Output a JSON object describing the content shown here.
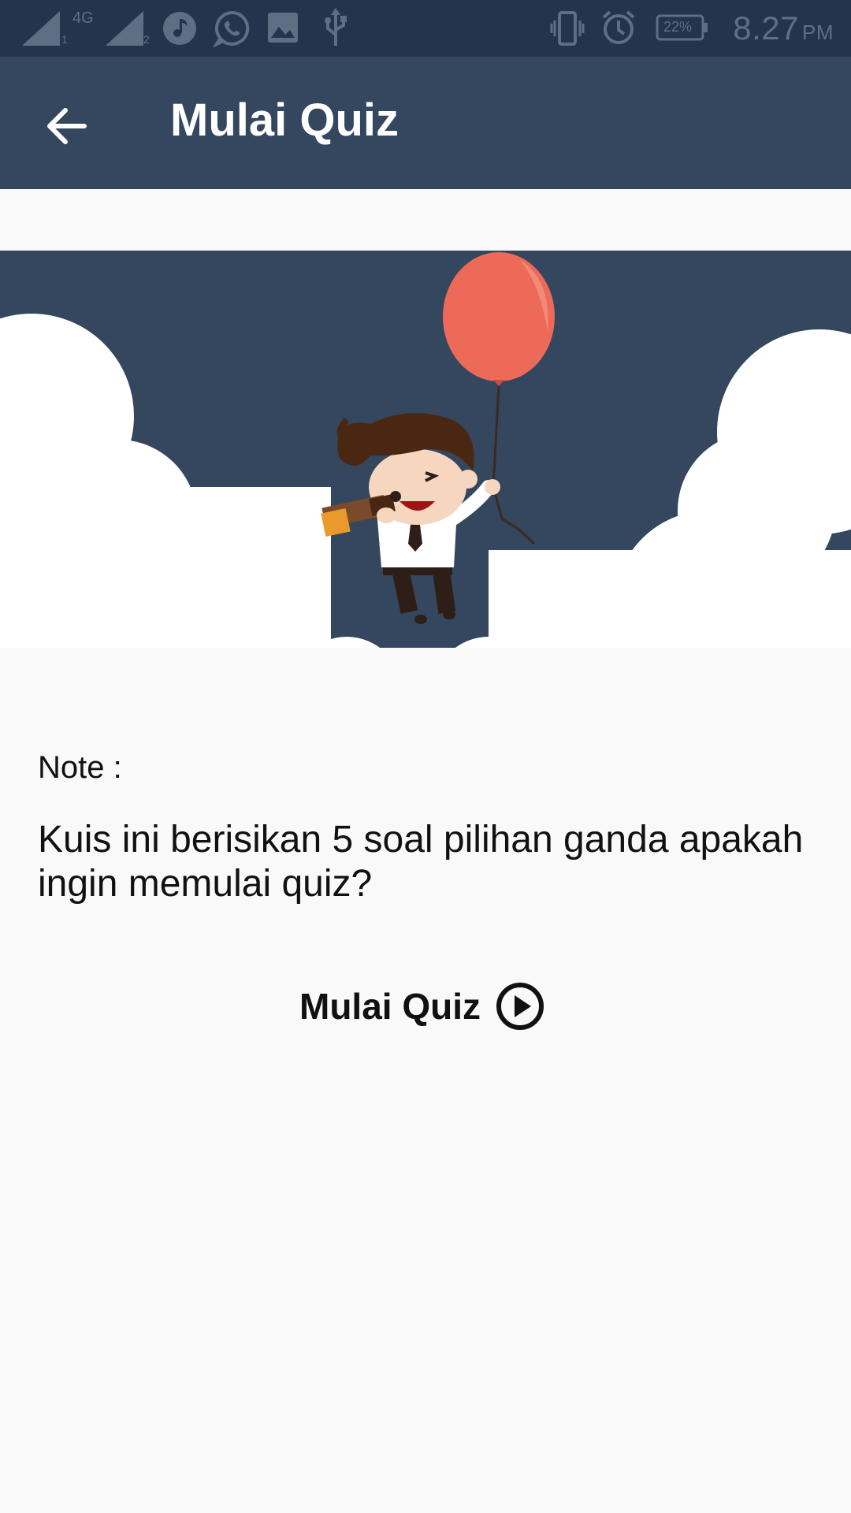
{
  "status_bar": {
    "network_label": "4G",
    "sim1_label": "1",
    "sim2_label": "2",
    "battery": "22%",
    "time": "8.27",
    "ampm": "PM",
    "icons": [
      "signal-icon",
      "signal-icon",
      "music-icon",
      "whatsapp-icon",
      "gallery-icon",
      "usb-icon",
      "vibrate-icon",
      "alarm-icon",
      "battery-icon"
    ]
  },
  "app_bar": {
    "title": "Mulai Quiz",
    "back_icon": "arrow-left-icon"
  },
  "content": {
    "note_label": "Note :",
    "note_text": "Kuis ini berisikan 5 soal pilihan ganda apakah ingin memulai quiz?",
    "start_button_label": "Mulai Quiz",
    "start_icon": "play-circle-icon"
  },
  "colors": {
    "status_bar": "#24344d",
    "app_bar": "#34475f",
    "hero_bg": "#34475f",
    "balloon": "#ee6a58",
    "background": "#f9f9f9"
  }
}
